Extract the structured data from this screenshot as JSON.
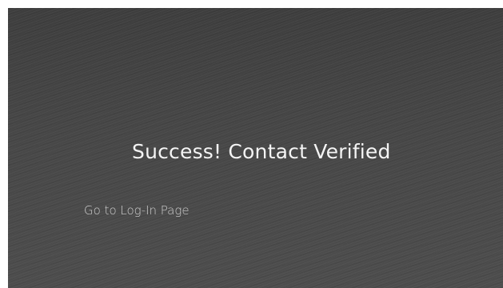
{
  "verification": {
    "headline": "Success! Contact Verified",
    "login_link_label": "Go to Log-In Page"
  },
  "colors": {
    "background": "#4b4b4b",
    "headline_text": "#f4f4f4",
    "link_text": "#cfcfcf"
  }
}
